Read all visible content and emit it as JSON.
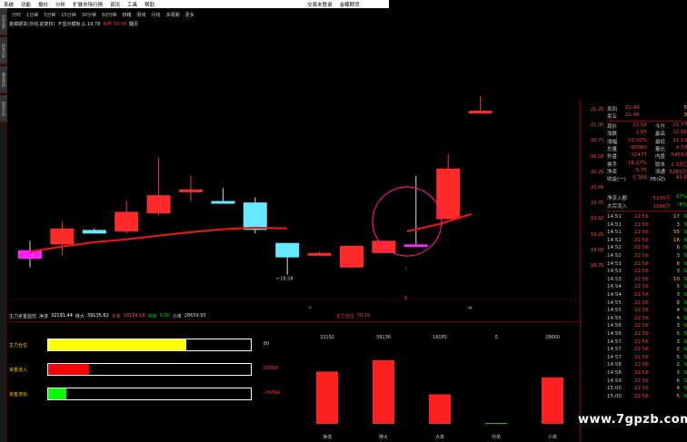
{
  "menu": [
    "系统",
    "功能",
    "报价",
    "分析",
    "扩展市场行情",
    "资讯",
    "工具",
    "帮助"
  ],
  "menu_right": [
    "交易未登录",
    "金蝶期货"
  ],
  "left_tabs": [
    "分时走势",
    "技术分析",
    "基本资料",
    "财务分析"
  ],
  "periods": [
    "分时",
    "1分钟",
    "5分钟",
    "15分钟",
    "30分钟",
    "60分钟",
    "日线",
    "周线",
    "月线",
    "多周期",
    "更多"
  ],
  "active_period": "日线",
  "info_line": {
    "name": "金蝶期货(日线,前复权)",
    "rest": "不显示模板 JL 19.78",
    "value": "世界 19.78",
    "extra": "翻页"
  },
  "price_axis": [
    "21.25",
    "21.00",
    "20.75",
    "20.50",
    "20.25",
    "20.00",
    "19.75",
    "19.50",
    "19.25",
    "19.00",
    "18.75"
  ],
  "low_label": "←18.58",
  "quote": {
    "ask4": {
      "label": "卖四",
      "price": "22.49",
      "vol": "5"
    },
    "ask5": {
      "label": "卖五",
      "price": "22.46",
      "vol": "3"
    },
    "rows": [
      {
        "a": "现价",
        "b": "22.56",
        "c": "今开",
        "d": "21.77"
      },
      {
        "a": "涨跌",
        "b": "2.65",
        "c": "最高",
        "d": "22.56"
      },
      {
        "a": "涨幅",
        "b": "10.00%",
        "c": "最低",
        "d": "21.11"
      },
      {
        "a": "总量",
        "b": "85080",
        "c": "量比",
        "d": "4.70"
      },
      {
        "a": "外盘",
        "b": "31477",
        "c": "内盘",
        "d": "54552"
      },
      {
        "a": "换手",
        "b": "16.27%",
        "c": "股本",
        "d": "1.33亿"
      },
      {
        "a": "净资",
        "b": "5.75",
        "c": "流通",
        "d": "5283万"
      },
      {
        "a": "收益(一)",
        "b": "0.388",
        "c": "PE(动)",
        "d": "43.6"
      }
    ],
    "inflow1": {
      "label": "净流入额",
      "v1": "-5235万",
      "v2": "-27%"
    },
    "inflow2": {
      "label": "大宗流入",
      "v1": "-1566万",
      "v2": "-8%"
    }
  },
  "ticks": [
    {
      "t": "14:51",
      "p": "22.56",
      "v": "17",
      "s": "S"
    },
    {
      "t": "14:51",
      "p": "22.56",
      "v": "3",
      "s": "S"
    },
    {
      "t": "14:51",
      "p": "22.56",
      "v": "55",
      "s": "S"
    },
    {
      "t": "14:52",
      "p": "22.56",
      "v": "16",
      "s": "S"
    },
    {
      "t": "14:52",
      "p": "22.56",
      "v": "6",
      "s": "S"
    },
    {
      "t": "14:52",
      "p": "22.56",
      "v": "3",
      "s": "S"
    },
    {
      "t": "14:53",
      "p": "22.56",
      "v": "6",
      "s": "S"
    },
    {
      "t": "14:53",
      "p": "22.56",
      "v": "3",
      "s": "S"
    },
    {
      "t": "14:53",
      "p": "22.56",
      "v": "10",
      "s": "S"
    },
    {
      "t": "14:54",
      "p": "22.56",
      "v": "5",
      "s": "S"
    },
    {
      "t": "14:54",
      "p": "22.56",
      "v": "3",
      "s": "S"
    },
    {
      "t": "14:55",
      "p": "22.56",
      "v": "8",
      "s": "S"
    },
    {
      "t": "14:55",
      "p": "22.56",
      "v": "4",
      "s": "S"
    },
    {
      "t": "14:55",
      "p": "22.56",
      "v": "4",
      "s": "S"
    },
    {
      "t": "14:56",
      "p": "22.56",
      "v": "3",
      "s": "S"
    },
    {
      "t": "14:56",
      "p": "22.56",
      "v": "5",
      "s": "S"
    },
    {
      "t": "14:57",
      "p": "22.56",
      "v": "3",
      "s": "S"
    },
    {
      "t": "14:57",
      "p": "22.56",
      "v": "2",
      "s": "S"
    },
    {
      "t": "14:57",
      "p": "22.56",
      "v": "5",
      "s": "S"
    },
    {
      "t": "14:58",
      "p": "22.56",
      "v": "2",
      "s": "S"
    },
    {
      "t": "14:58",
      "p": "22.56",
      "v": "3",
      "s": "S"
    },
    {
      "t": "14:59",
      "p": "22.56",
      "v": "6",
      "s": "S"
    },
    {
      "t": "15:00",
      "p": "22.56",
      "v": "4",
      "s": "S"
    },
    {
      "t": "15:00",
      "p": "22.56",
      "v": "5",
      "s": "S"
    }
  ],
  "markers": {
    "m1": "↑",
    "m2": "B",
    "m3": "减",
    "m4": "低"
  },
  "indicator": {
    "name": "主力资金监控",
    "net_label": "净流",
    "net_val": "32191.44",
    "t1_label": "特大",
    "t1_val": "39135.62",
    "t2_label": "大单",
    "t2_val": "18184.18",
    "t3_label": "中单",
    "t3_val": "0.00",
    "t4_label": "小单",
    "t4_val": "28659.95",
    "pos_label": "主力仓位",
    "pos_val": "79.19"
  },
  "bars": [
    {
      "label": "主力仓位",
      "value": "80",
      "fraction": 0.68,
      "color": "#ffff00"
    },
    {
      "label": "资金流入",
      "value": "58888",
      "fraction": 0.2,
      "color": "#ff0000"
    },
    {
      "label": "资金流出",
      "value": "-26894",
      "fraction": 0.09,
      "color": "#00ff00"
    }
  ],
  "flow_bars": [
    {
      "label": "净流",
      "value": "32192",
      "amount": 32192,
      "color": "#ff2020"
    },
    {
      "label": "特大",
      "value": "39136",
      "amount": 39136,
      "color": "#ff2020"
    },
    {
      "label": "大单",
      "value": "18185",
      "amount": 18185,
      "color": "#ff2020"
    },
    {
      "label": "中单",
      "value": "0",
      "amount": 0,
      "color": "#00cc00"
    },
    {
      "label": "小单",
      "value": "28660",
      "amount": 28660,
      "color": "#ff2020"
    }
  ],
  "candles": [
    {
      "o": 19.2,
      "c": 19.32,
      "h": 19.45,
      "l": 19.08,
      "color": "magenta"
    },
    {
      "o": 19.4,
      "c": 19.62,
      "h": 19.72,
      "l": 19.25,
      "color": "red"
    },
    {
      "o": 19.55,
      "c": 19.6,
      "h": 19.62,
      "l": 19.55,
      "color": "cyan"
    },
    {
      "o": 19.58,
      "c": 19.85,
      "h": 20.0,
      "l": 19.55,
      "color": "red"
    },
    {
      "o": 19.83,
      "c": 20.08,
      "h": 20.6,
      "l": 19.8,
      "color": "red"
    },
    {
      "o": 20.15,
      "c": 20.16,
      "h": 20.35,
      "l": 20.0,
      "color": "red"
    },
    {
      "o": 20.0,
      "c": 19.98,
      "h": 20.18,
      "l": 19.98,
      "color": "cyan"
    },
    {
      "o": 19.98,
      "c": 19.6,
      "h": 20.05,
      "l": 19.55,
      "color": "cyan"
    },
    {
      "o": 19.42,
      "c": 19.22,
      "h": 19.42,
      "l": 18.98,
      "color": "cyan"
    },
    {
      "o": 19.27,
      "c": 19.28,
      "h": 19.3,
      "l": 19.25,
      "color": "red"
    },
    {
      "o": 19.08,
      "c": 19.38,
      "h": 19.38,
      "l": 19.08,
      "color": "red"
    },
    {
      "o": 19.28,
      "c": 19.45,
      "h": 19.45,
      "l": 19.28,
      "color": "red"
    },
    {
      "o": 19.38,
      "c": 19.4,
      "h": 20.35,
      "l": 19.38,
      "color": "magenta"
    },
    {
      "o": 19.75,
      "c": 20.45,
      "h": 20.65,
      "l": 19.75,
      "color": "red"
    },
    {
      "o": 21.25,
      "c": 21.25,
      "h": 21.45,
      "l": 21.25,
      "color": "red"
    }
  ],
  "ma_line": [
    19.3,
    19.37,
    19.43,
    19.47,
    19.52,
    19.57,
    19.61,
    19.63,
    19.62
  ],
  "ma_line2": [
    19.58,
    19.68,
    19.82
  ]
}
